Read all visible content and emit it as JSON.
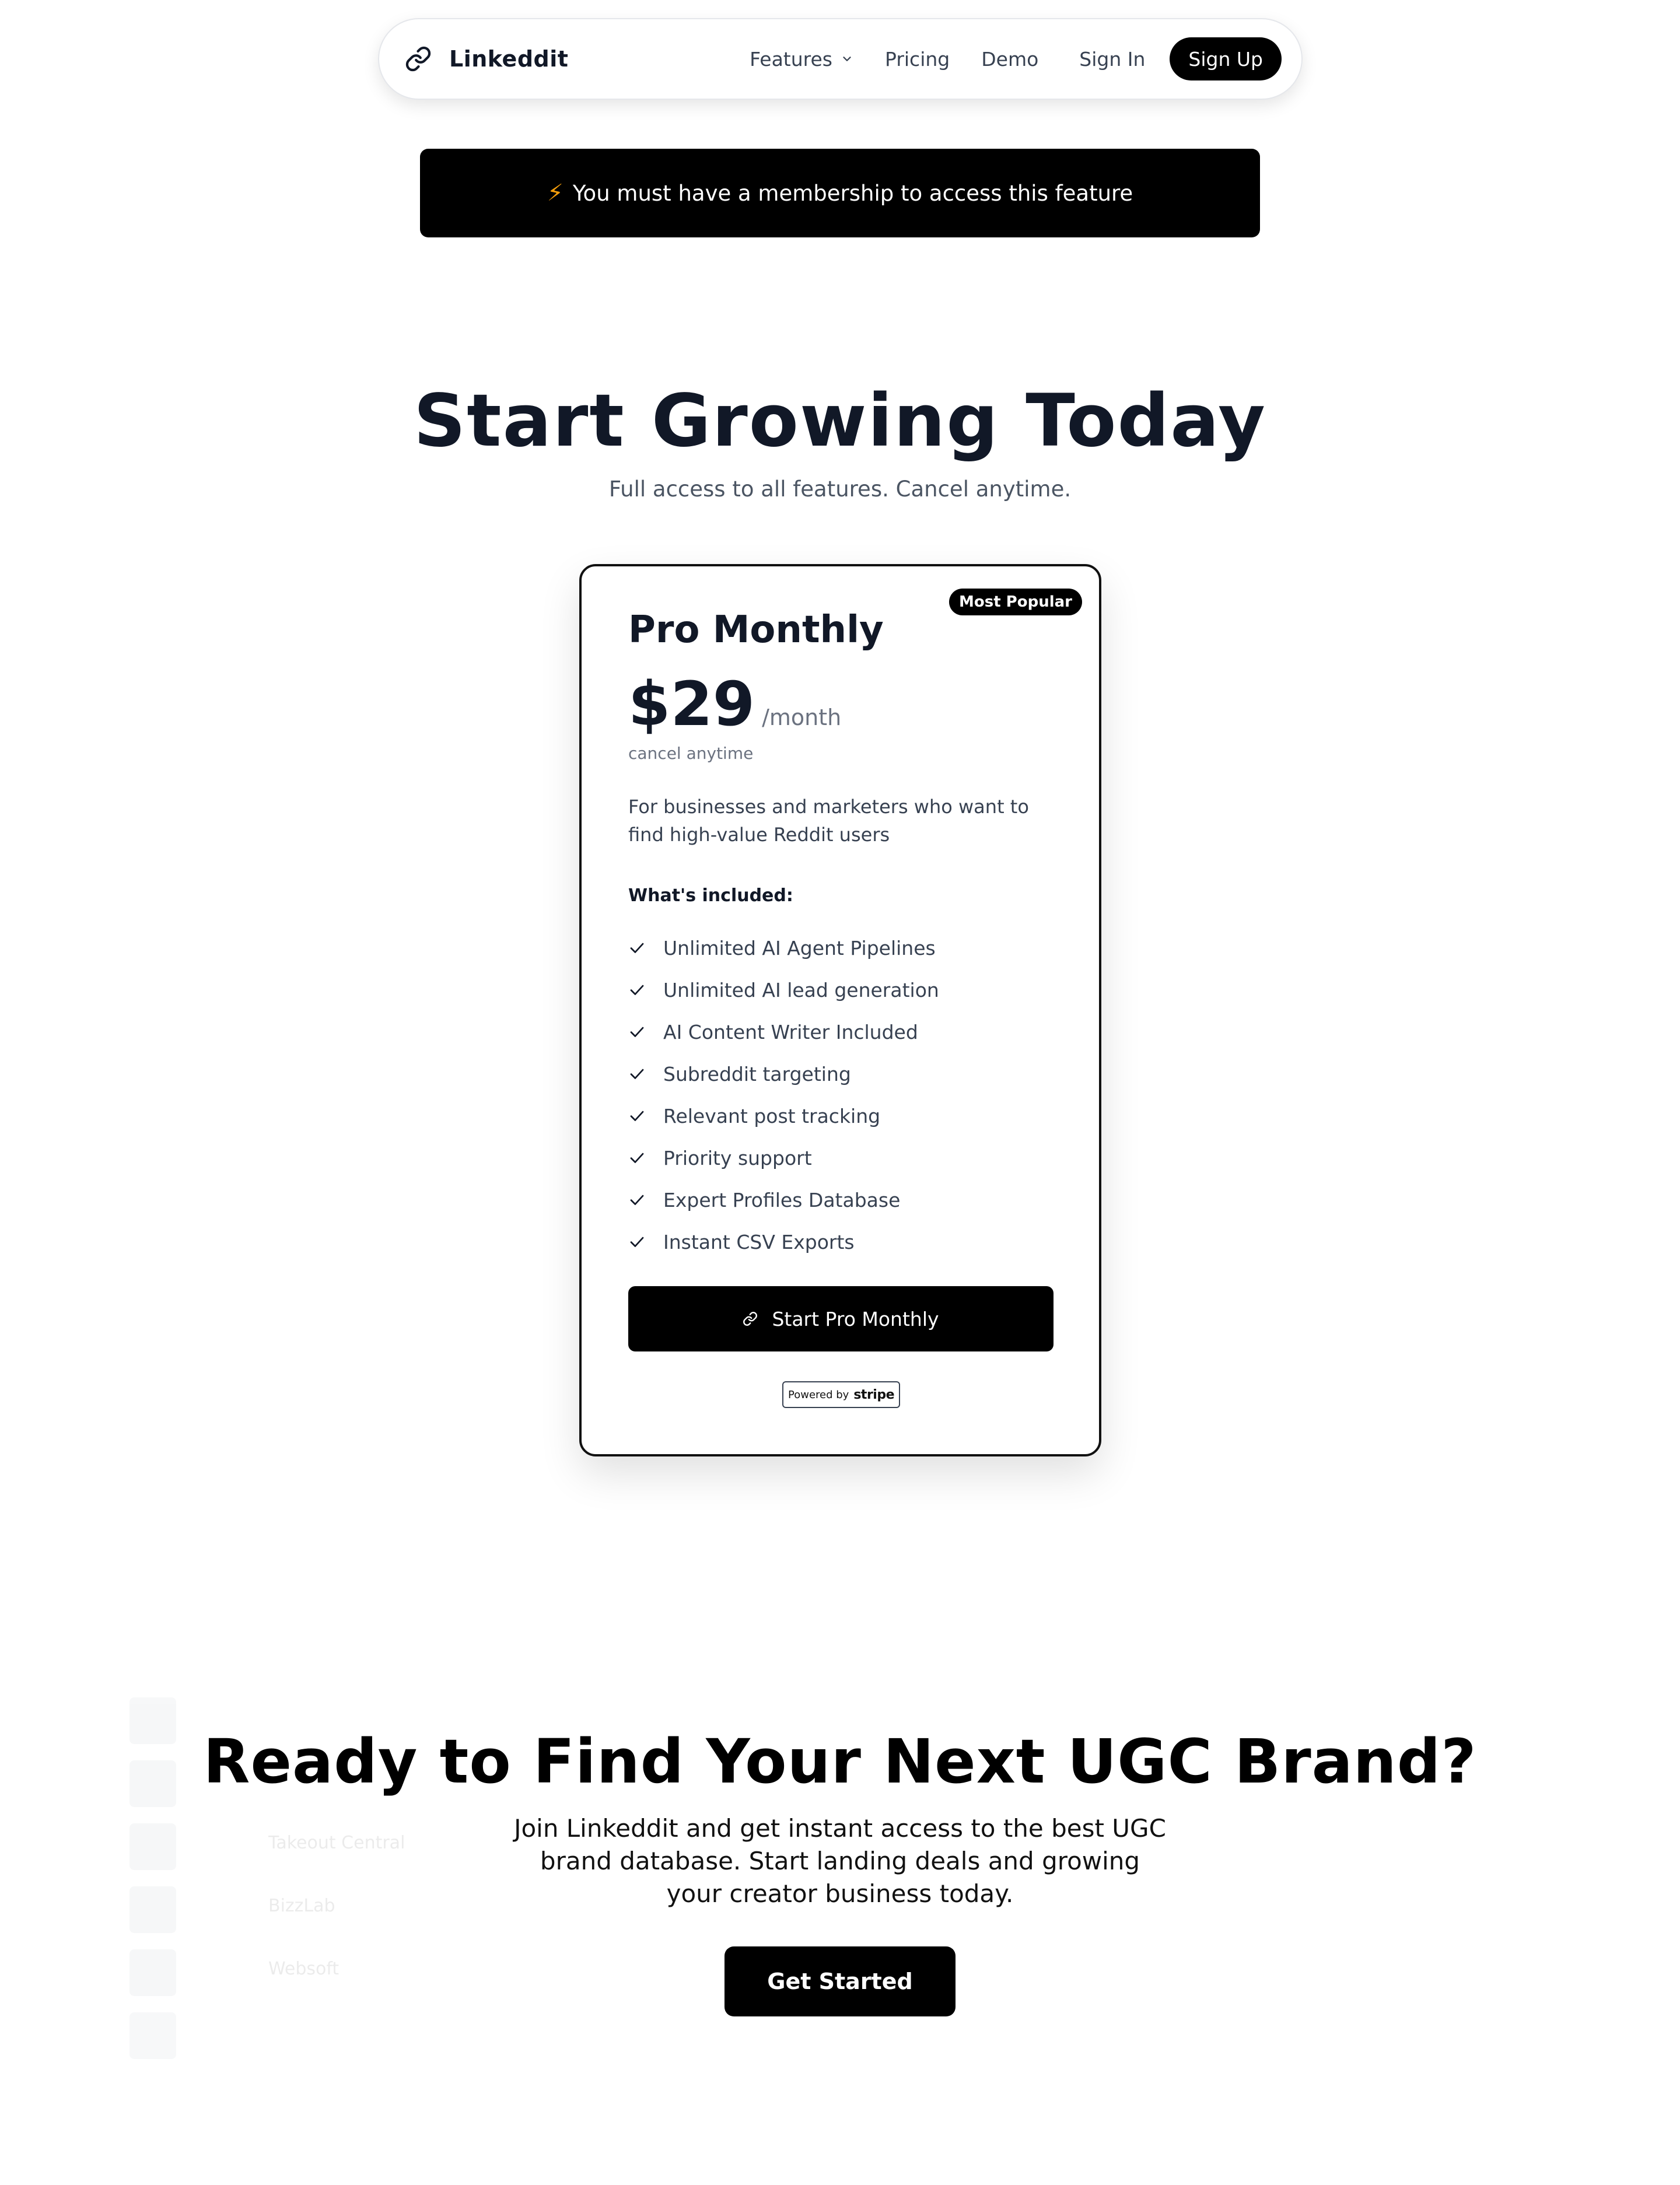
{
  "nav": {
    "brand": "Linkeddit",
    "brand_icon": "link-icon",
    "links": {
      "features": "Features",
      "pricing": "Pricing",
      "demo": "Demo",
      "signin": "Sign In",
      "signup": "Sign Up"
    }
  },
  "banner": {
    "icon": "⚡",
    "text": "You must have a membership to access this feature"
  },
  "hero": {
    "title": "Start Growing Today",
    "subtitle": "Full access to all features. Cancel anytime."
  },
  "plan": {
    "badge": "Most Popular",
    "name": "Pro Monthly",
    "price": "$29",
    "period": "/month",
    "note": "cancel anytime",
    "description": "For businesses and marketers who want to find high-value Reddit users",
    "included_heading": "What's included:",
    "features": [
      "Unlimited AI Agent Pipelines",
      "Unlimited AI lead generation",
      "AI Content Writer Included",
      "Subreddit targeting",
      "Relevant post tracking",
      "Priority support",
      "Expert Profiles Database",
      "Instant CSV Exports"
    ],
    "cta": "Start Pro Monthly",
    "stripe_powered_by": "Powered by",
    "stripe_name": "stripe"
  },
  "background_table": {
    "rows": [
      {
        "name": "Takeout Central"
      },
      {
        "name": "BizzLab"
      },
      {
        "name": "Websoft"
      }
    ]
  },
  "bottom": {
    "title": "Ready to Find Your Next UGC Brand?",
    "subtitle": "Join Linkeddit and get instant access to the best UGC brand database. Start landing deals and growing your creator business today.",
    "cta": "Get Started"
  },
  "colors": {
    "primary": "#000000",
    "heading": "#111827",
    "body_text": "#374151",
    "muted": "#6b7280",
    "bolt": "#f59e0b"
  }
}
